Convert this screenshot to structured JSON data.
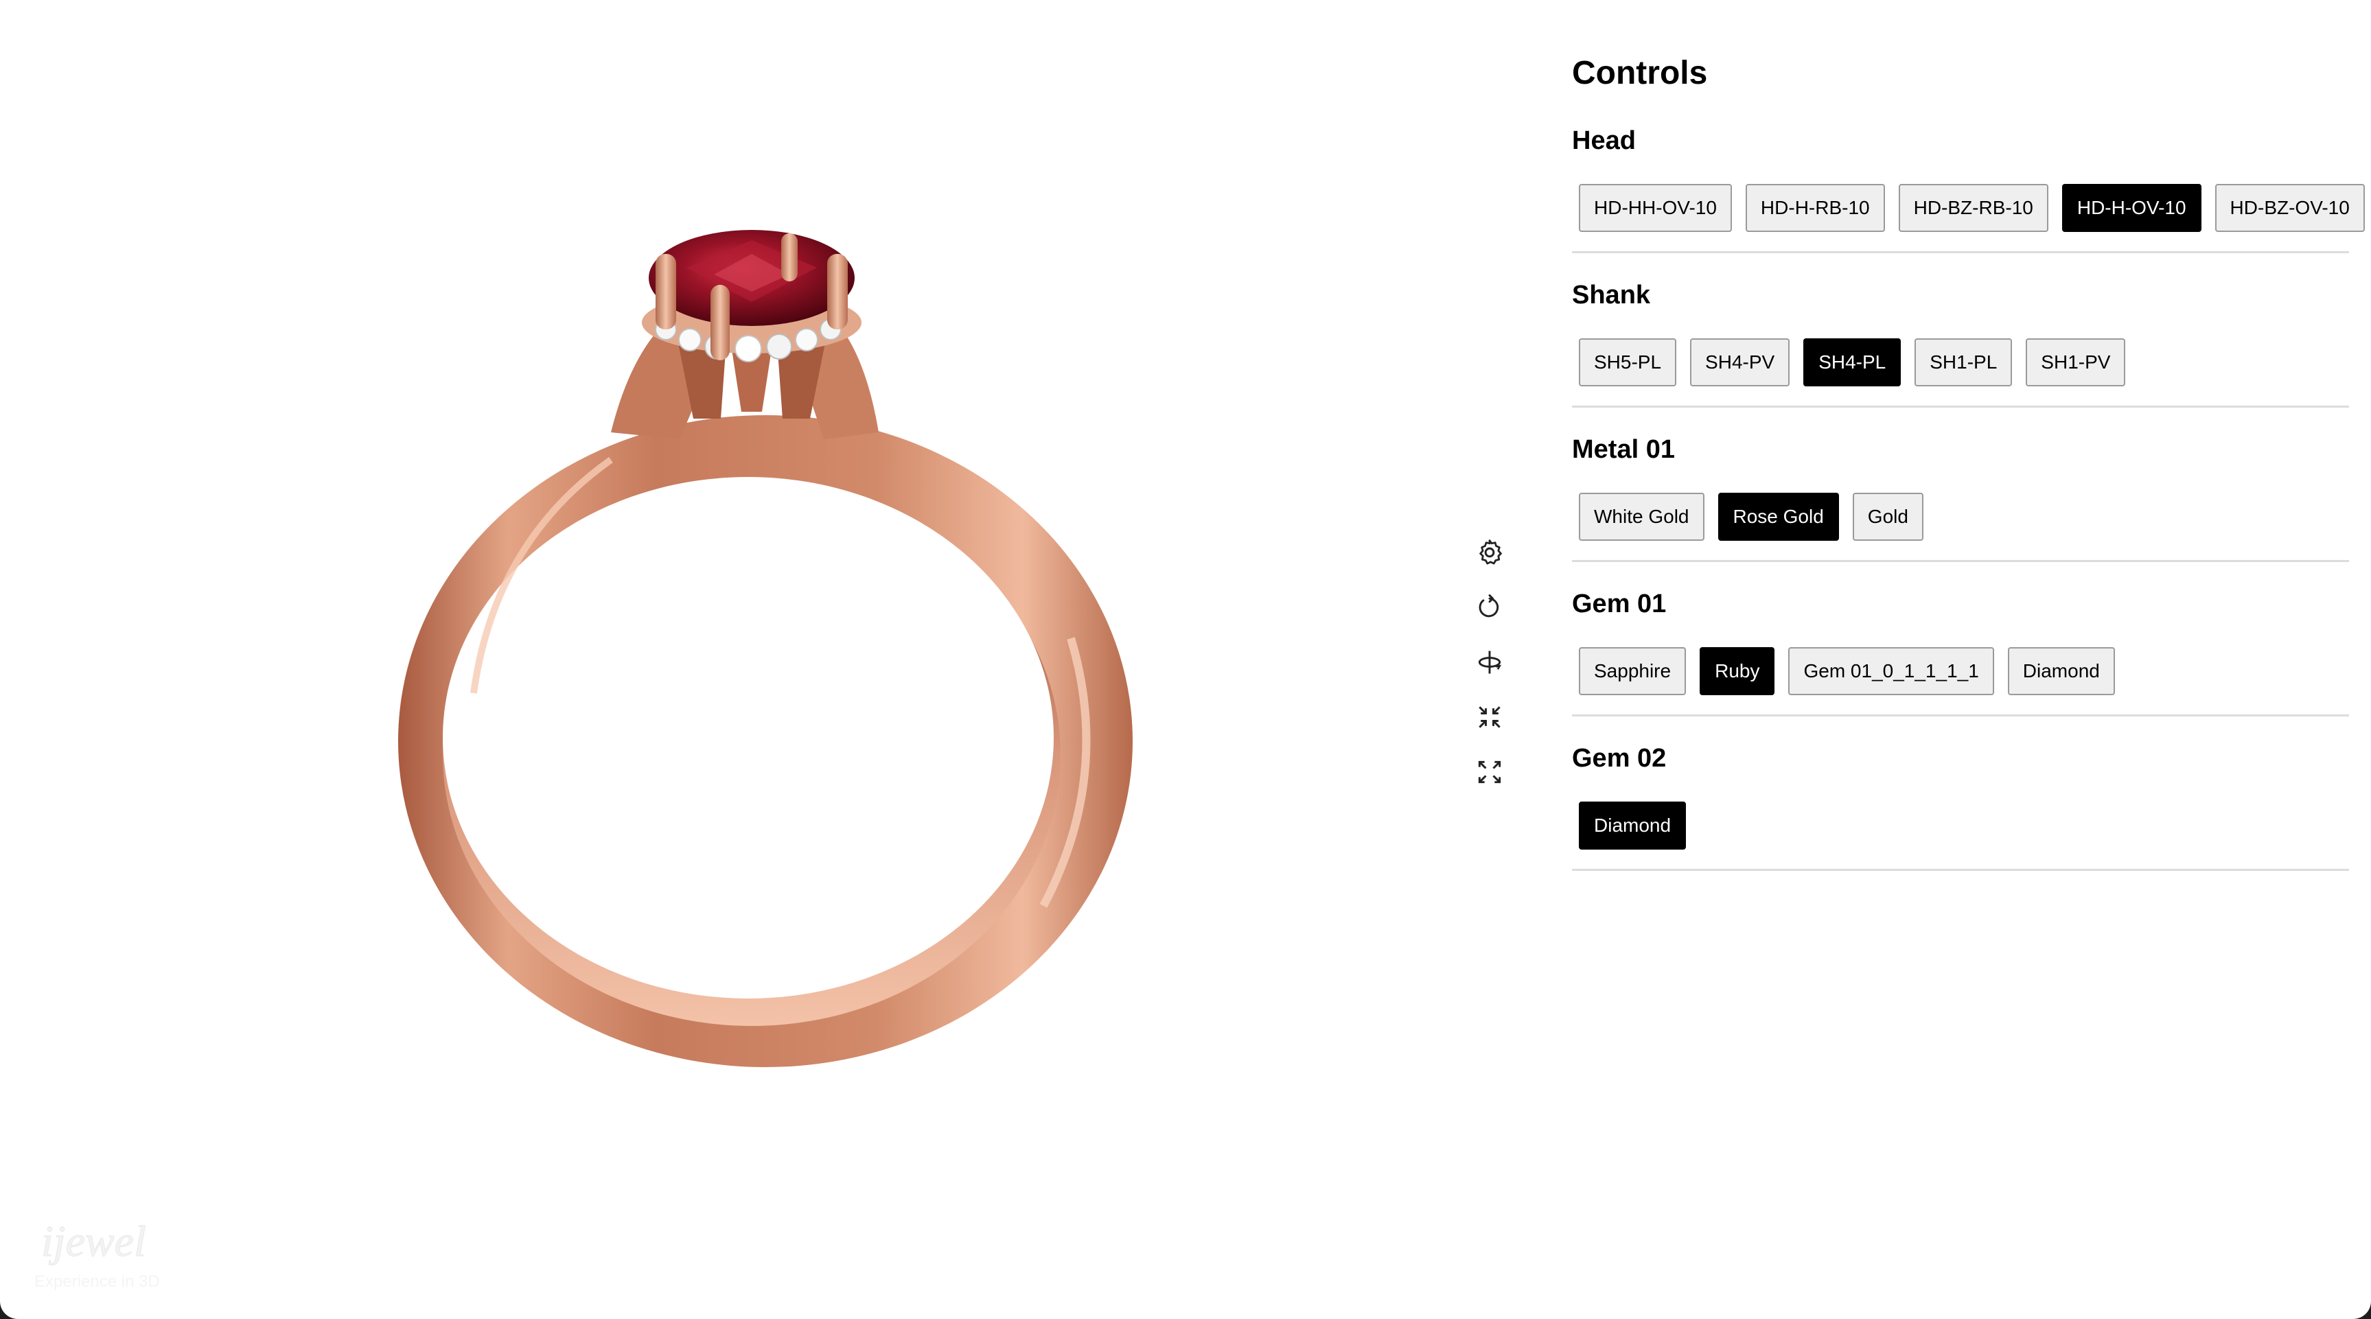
{
  "panel": {
    "title": "Controls",
    "sections": [
      {
        "title": "Head",
        "options": [
          {
            "label": "HD-HH-OV-10",
            "selected": false
          },
          {
            "label": "HD-H-RB-10",
            "selected": false
          },
          {
            "label": "HD-BZ-RB-10",
            "selected": false
          },
          {
            "label": "HD-H-OV-10",
            "selected": true
          },
          {
            "label": "HD-BZ-OV-10",
            "selected": false
          }
        ]
      },
      {
        "title": "Shank",
        "options": [
          {
            "label": "SH5-PL",
            "selected": false
          },
          {
            "label": "SH4-PV",
            "selected": false
          },
          {
            "label": "SH4-PL",
            "selected": true
          },
          {
            "label": "SH1-PL",
            "selected": false
          },
          {
            "label": "SH1-PV",
            "selected": false
          }
        ]
      },
      {
        "title": "Metal 01",
        "options": [
          {
            "label": "White Gold",
            "selected": false
          },
          {
            "label": "Rose Gold",
            "selected": true
          },
          {
            "label": "Gold",
            "selected": false
          }
        ]
      },
      {
        "title": "Gem 01",
        "options": [
          {
            "label": "Sapphire",
            "selected": false
          },
          {
            "label": "Ruby",
            "selected": true
          },
          {
            "label": "Gem 01_0_1_1_1_1",
            "selected": false
          },
          {
            "label": "Diamond",
            "selected": false
          }
        ]
      },
      {
        "title": "Gem 02",
        "options": [
          {
            "label": "Diamond",
            "selected": true
          }
        ]
      }
    ]
  },
  "toolbar": {
    "tools": [
      "gear-icon",
      "reset-rotation-icon",
      "rotate-axis-icon",
      "collapse-icon",
      "fullscreen-icon"
    ]
  },
  "watermark": {
    "logo_text": "ijewel",
    "tagline": "Experience in 3D"
  },
  "colors": {
    "selected_bg": "#000000",
    "unselected_bg": "#efefef",
    "metal": "#c98365",
    "gem": "#8e1022"
  }
}
